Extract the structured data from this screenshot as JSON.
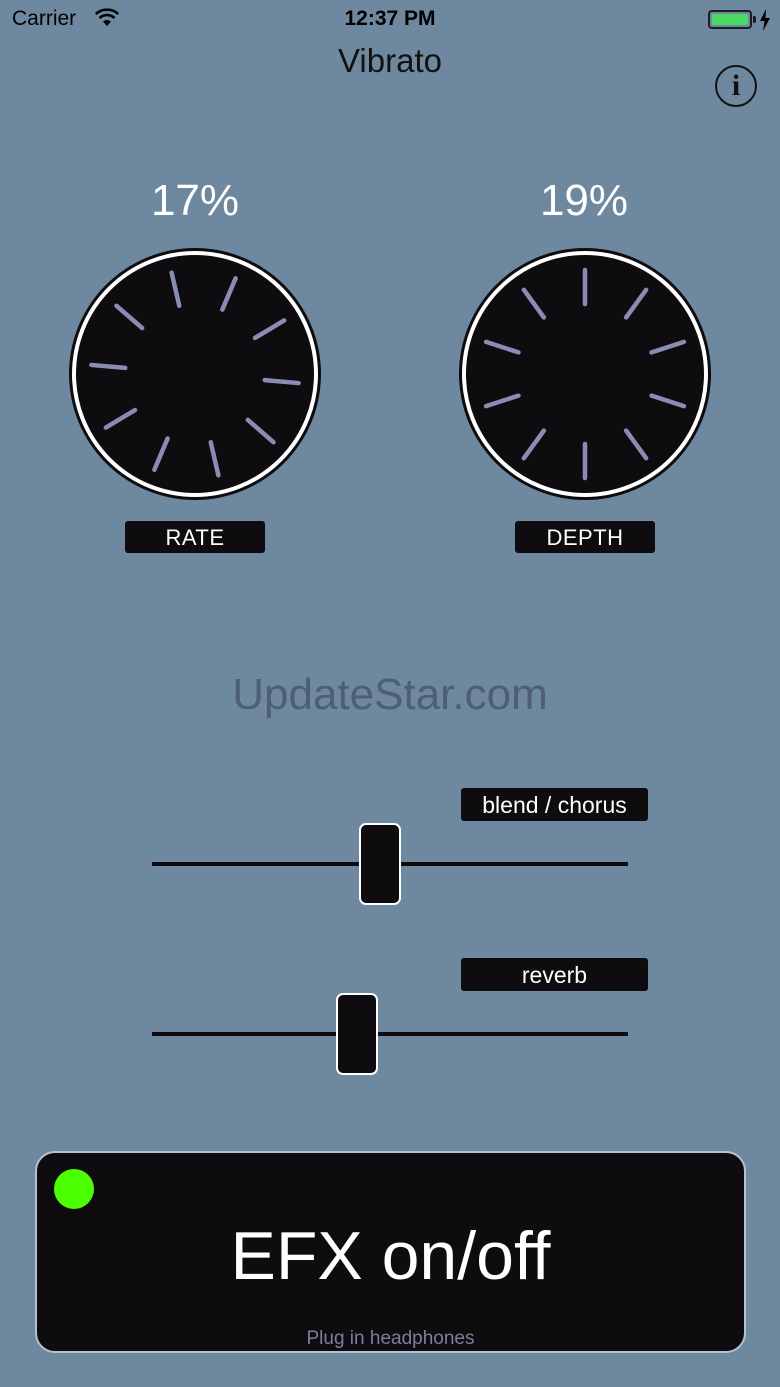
{
  "status_bar": {
    "carrier": "Carrier",
    "time": "12:37 PM",
    "battery_color": "#4cd964"
  },
  "header": {
    "title": "Vibrato",
    "info_icon": "i"
  },
  "knobs": [
    {
      "name": "rate",
      "value": "17%",
      "label": "RATE",
      "rotation_deg": 23
    },
    {
      "name": "depth",
      "value": "19%",
      "label": "DEPTH",
      "rotation_deg": 0
    }
  ],
  "watermark": "UpdateStar.com",
  "sliders": [
    {
      "name": "blend-chorus",
      "label": "blend / chorus",
      "value_fraction": 0.48
    },
    {
      "name": "reverb",
      "label": "reverb",
      "value_fraction": 0.43
    }
  ],
  "efx": {
    "label": "EFX on/off",
    "hint": "Plug in headphones",
    "led_color": "#4cff00",
    "led_on": true
  },
  "colors": {
    "background": "#6e899f",
    "panel": "#0e0c0f",
    "tick": "#8a8cb3"
  }
}
